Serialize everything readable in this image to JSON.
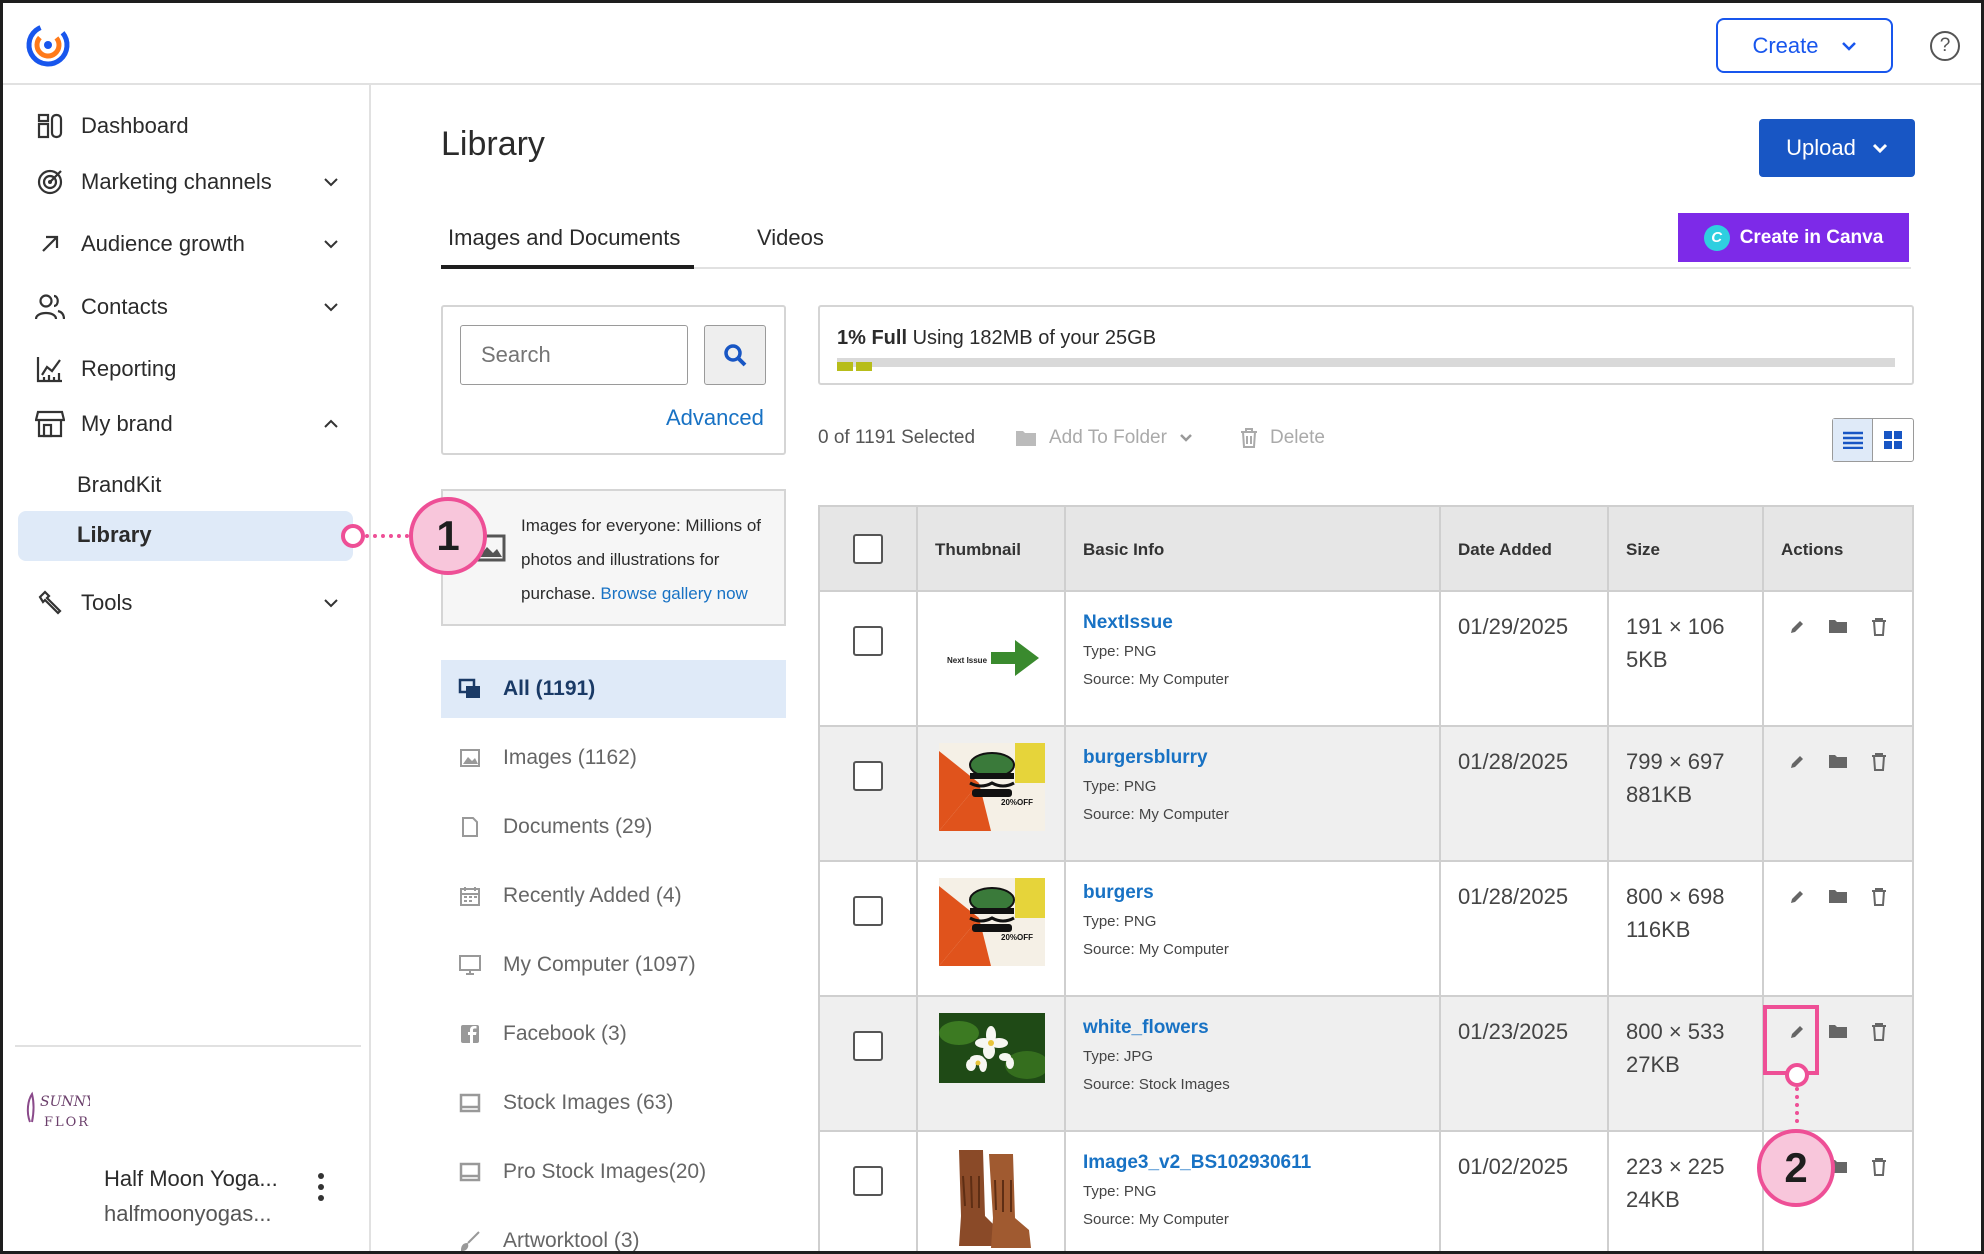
{
  "header": {
    "create_label": "Create",
    "help_label": "?"
  },
  "sidebar": {
    "items": [
      {
        "label": "Dashboard"
      },
      {
        "label": "Marketing channels"
      },
      {
        "label": "Audience growth"
      },
      {
        "label": "Contacts"
      },
      {
        "label": "Reporting"
      },
      {
        "label": "My brand"
      },
      {
        "label": "Tools"
      }
    ],
    "sub_items": [
      {
        "label": "BrandKit"
      },
      {
        "label": "Library"
      }
    ],
    "account": {
      "name": "Half Moon Yoga...",
      "sub": "halfmoonyogas..."
    }
  },
  "main": {
    "title": "Library",
    "upload_label": "Upload",
    "tabs": [
      {
        "label": "Images and Documents"
      },
      {
        "label": "Videos"
      }
    ],
    "canva_label": "Create in Canva",
    "search": {
      "placeholder": "Search",
      "advanced": "Advanced"
    },
    "promo": {
      "text": "Images for everyone: Millions of photos and illustrations for purchase.",
      "link": "Browse gallery now"
    },
    "categories": [
      {
        "label": "All (1191)"
      },
      {
        "label": "Images (1162)"
      },
      {
        "label": "Documents (29)"
      },
      {
        "label": "Recently Added (4)"
      },
      {
        "label": "My Computer (1097)"
      },
      {
        "label": "Facebook (3)"
      },
      {
        "label": "Stock Images (63)"
      },
      {
        "label": "Pro Stock Images(20)"
      },
      {
        "label": "Artworktool (3)"
      }
    ],
    "storage": {
      "percent_label": "1% Full",
      "usage_text": "Using 182MB of your 25GB",
      "fraction": 0.01
    },
    "toolbar": {
      "selected": "0 of 1191 Selected",
      "add_to_folder": "Add To Folder",
      "delete": "Delete"
    },
    "table": {
      "headers": [
        "Thumbnail",
        "Basic Info",
        "Date Added",
        "Size",
        "Actions"
      ],
      "rows": [
        {
          "name": "NextIssue",
          "type": "Type: PNG",
          "source": "Source: My Computer",
          "date": "01/29/2025",
          "dims": "191 × 106",
          "filesize": "5KB",
          "thumb_text": "Next Issue"
        },
        {
          "name": "burgersblurry",
          "type": "Type: PNG",
          "source": "Source: My Computer",
          "date": "01/28/2025",
          "dims": "799 × 697",
          "filesize": "881KB",
          "thumb_text": "20%OFF"
        },
        {
          "name": "burgers",
          "type": "Type: PNG",
          "source": "Source: My Computer",
          "date": "01/28/2025",
          "dims": "800 × 698",
          "filesize": "116KB",
          "thumb_text": "20%OFF"
        },
        {
          "name": "white_flowers",
          "type": "Type: JPG",
          "source": "Source: Stock Images",
          "date": "01/23/2025",
          "dims": "800 × 533",
          "filesize": "27KB"
        },
        {
          "name": "Image3_v2_BS102930611",
          "type": "Type: PNG",
          "source": "Source: My Computer",
          "date": "01/02/2025",
          "dims": "223 × 225",
          "filesize": "24KB"
        }
      ]
    }
  },
  "annotations": {
    "callout_1": "1",
    "callout_2": "2"
  },
  "colors": {
    "brand_blue": "#1856c4",
    "canva_purple": "#7d2ae8",
    "annotation_pink": "#ee4f96",
    "link_blue": "#1872c4"
  }
}
